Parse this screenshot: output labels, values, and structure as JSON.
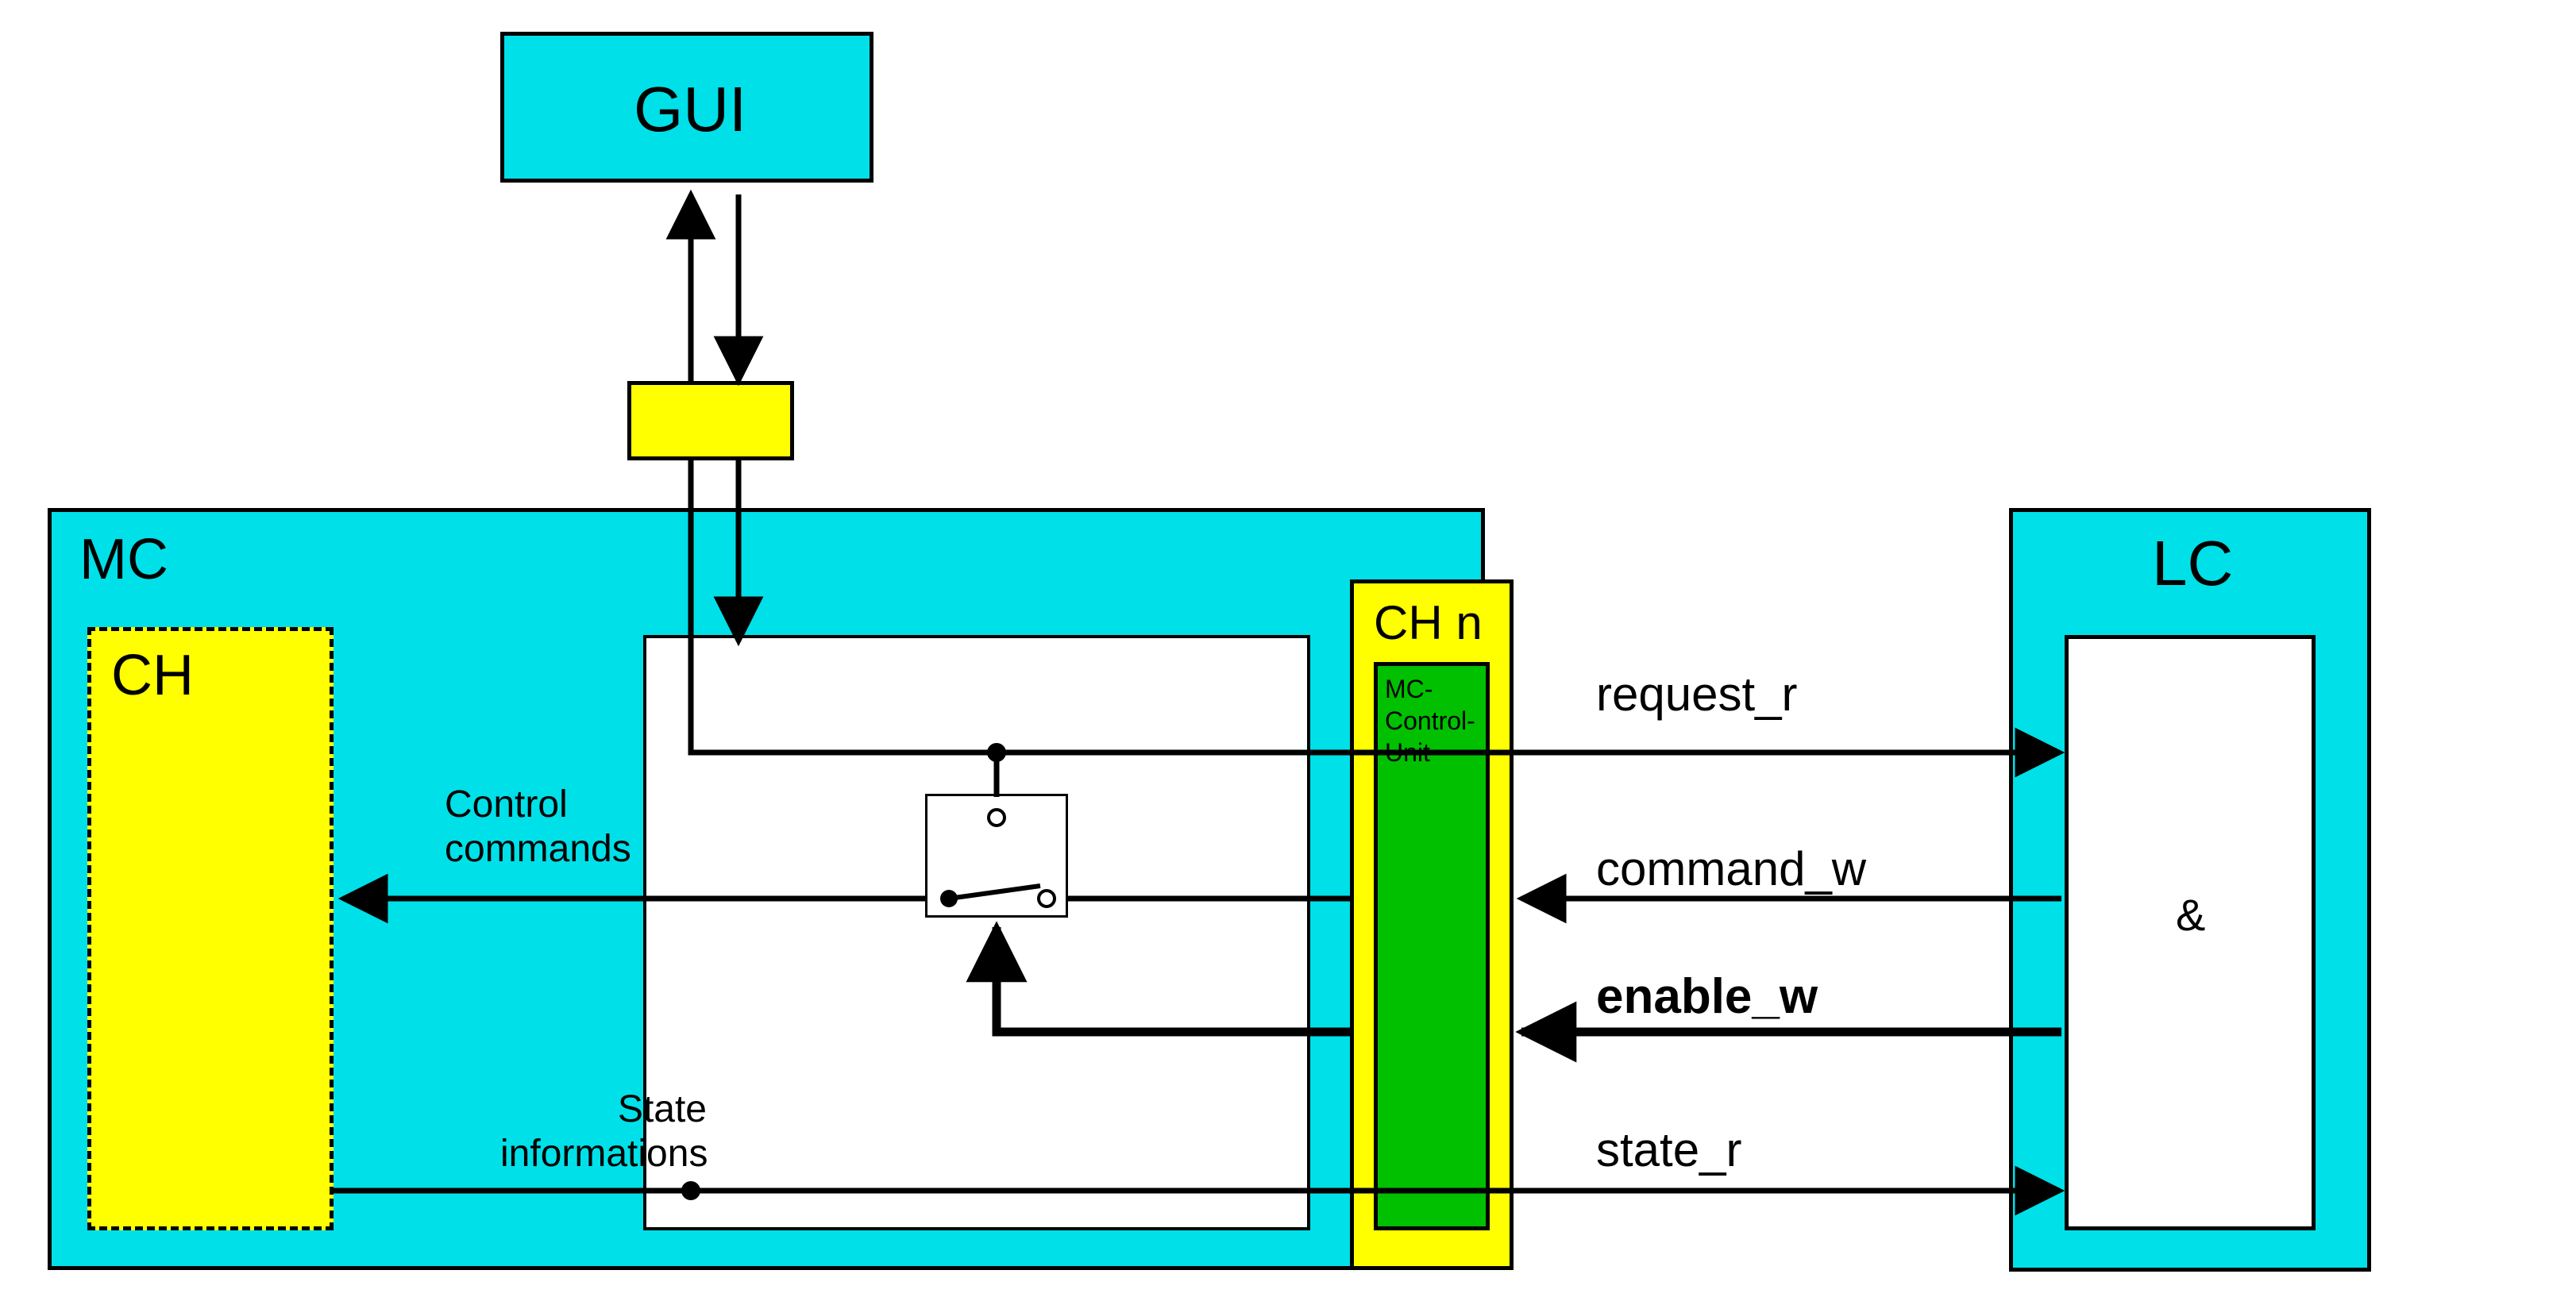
{
  "colors": {
    "cyan": "#00e0e8",
    "yellow": "#ffff00",
    "green": "#00c000",
    "white": "#ffffff",
    "black": "#000000"
  },
  "blocks": {
    "gui": {
      "label": "GUI"
    },
    "mc": {
      "label": "MC"
    },
    "ch": {
      "label": "CH"
    },
    "chn": {
      "label": "CH n"
    },
    "lc": {
      "label": "LC"
    },
    "mccu": {
      "label": "MC-\nControl-\nUnit"
    },
    "amp": {
      "label": "&"
    }
  },
  "signals": {
    "request_r": "request_r",
    "command_w": "command_w",
    "enable_w": "enable_w",
    "state_r": "state_r"
  },
  "labels": {
    "control_commands": "Control\ncommands",
    "state_informations": "State\ninformations"
  }
}
